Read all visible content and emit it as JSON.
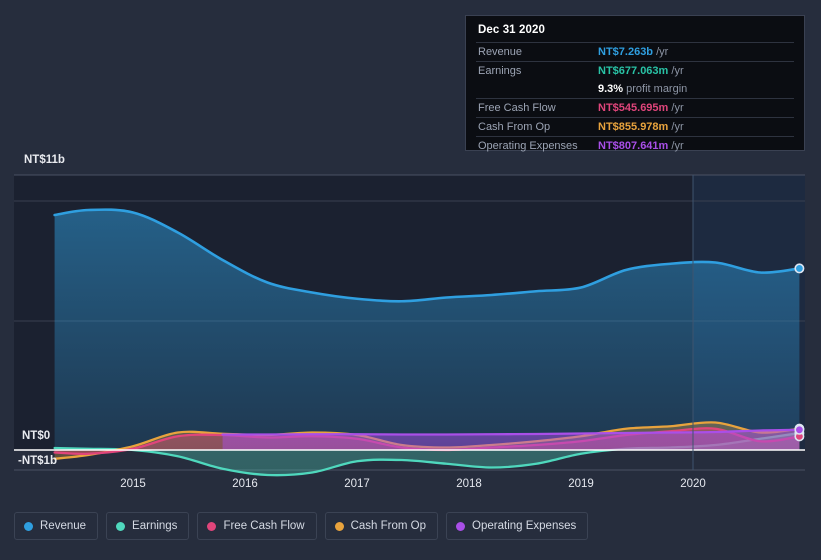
{
  "tooltip": {
    "date": "Dec 31 2020",
    "rows": [
      {
        "label": "Revenue",
        "value": "NT$7.263b",
        "unit": "/yr",
        "color": "#2f9fe0"
      },
      {
        "label": "Earnings",
        "value": "NT$677.063m",
        "unit": "/yr",
        "color": "#29c3a6"
      },
      {
        "label": "Free Cash Flow",
        "value": "NT$545.695m",
        "unit": "/yr",
        "color": "#e0457b"
      },
      {
        "label": "Cash From Op",
        "value": "NT$855.978m",
        "unit": "/yr",
        "color": "#e8a33d"
      },
      {
        "label": "Operating Expenses",
        "value": "NT$807.641m",
        "unit": "/yr",
        "color": "#a94fe8"
      }
    ],
    "margin_value": "9.3%",
    "margin_label": "profit margin"
  },
  "axis": {
    "y_top": "NT$11b",
    "y_zero": "NT$0",
    "y_negative": "-NT$1b",
    "x_ticks": [
      "2015",
      "2016",
      "2017",
      "2018",
      "2019",
      "2020"
    ]
  },
  "legend": {
    "items": [
      {
        "label": "Revenue",
        "color": "#2f9fe0"
      },
      {
        "label": "Earnings",
        "color": "#4fd8bd"
      },
      {
        "label": "Free Cash Flow",
        "color": "#e0457b"
      },
      {
        "label": "Cash From Op",
        "color": "#e8a33d"
      },
      {
        "label": "Operating Expenses",
        "color": "#a94fe8"
      }
    ]
  },
  "chart_data": {
    "type": "area",
    "title": "",
    "xlabel": "",
    "ylabel": "NT$",
    "ylim": [
      -1,
      11
    ],
    "grid": true,
    "legend_position": "bottom",
    "currency": "NT$",
    "x_tick_labels": [
      "2015",
      "2016",
      "2017",
      "2018",
      "2019",
      "2020"
    ],
    "x": [
      2014.3,
      2014.6,
      2015.0,
      2015.4,
      2015.8,
      2016.2,
      2016.6,
      2017.0,
      2017.4,
      2017.8,
      2018.2,
      2018.6,
      2019.0,
      2019.4,
      2019.8,
      2020.2,
      2020.6,
      2020.95
    ],
    "forecast_divider_x": 2020.0,
    "series": [
      {
        "name": "Revenue",
        "color": "#2f9fe0",
        "values": [
          9.4,
          9.6,
          9.5,
          8.7,
          7.6,
          6.7,
          6.3,
          6.05,
          5.95,
          6.1,
          6.2,
          6.35,
          6.5,
          7.2,
          7.45,
          7.5,
          7.1,
          7.263
        ]
      },
      {
        "name": "Earnings",
        "color": "#4fd8bd",
        "values": [
          0.08,
          0.05,
          0.0,
          -0.25,
          -0.75,
          -1.0,
          -0.9,
          -0.45,
          -0.4,
          -0.55,
          -0.7,
          -0.55,
          -0.15,
          0.05,
          0.1,
          0.2,
          0.45,
          0.677
        ]
      },
      {
        "name": "Free Cash Flow",
        "color": "#e0457b",
        "values": [
          -0.1,
          -0.15,
          0.05,
          0.55,
          0.6,
          0.5,
          0.55,
          0.45,
          0.1,
          0.0,
          0.1,
          0.2,
          0.35,
          0.6,
          0.75,
          0.85,
          0.35,
          0.546
        ]
      },
      {
        "name": "Cash From Op",
        "color": "#e8a33d",
        "values": [
          -0.35,
          -0.2,
          0.15,
          0.7,
          0.65,
          0.6,
          0.7,
          0.6,
          0.2,
          0.1,
          0.2,
          0.35,
          0.55,
          0.85,
          0.95,
          1.1,
          0.7,
          0.856
        ]
      },
      {
        "name": "Operating Expenses",
        "color": "#a94fe8",
        "values": [
          null,
          null,
          null,
          null,
          0.62,
          0.62,
          0.63,
          0.63,
          0.62,
          0.62,
          0.63,
          0.64,
          0.66,
          0.68,
          0.7,
          0.72,
          0.78,
          0.808
        ]
      }
    ]
  }
}
